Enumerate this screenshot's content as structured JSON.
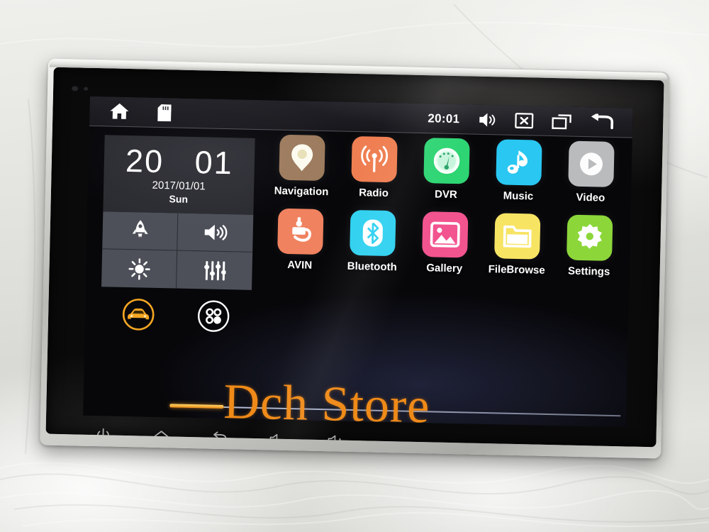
{
  "device": {
    "type": "android-car-head-unit",
    "bezel_color": "#c9c9c5",
    "screen_background": "#07070a"
  },
  "statusbar": {
    "left_icons": [
      {
        "name": "home-icon",
        "label": "Home"
      },
      {
        "name": "sd-card-icon",
        "label": "SD Card"
      }
    ],
    "time": "20:01",
    "right_icons": [
      {
        "name": "volume-icon",
        "label": "Volume"
      },
      {
        "name": "mute-x-icon",
        "label": "Mute"
      },
      {
        "name": "recent-apps-icon",
        "label": "Recent Apps"
      },
      {
        "name": "back-icon",
        "label": "Back"
      }
    ]
  },
  "clock_widget": {
    "hours": "20",
    "minutes": "01",
    "date": "2017/01/01",
    "weekday": "Sun"
  },
  "quick_tiles": [
    {
      "name": "rocket-icon",
      "label": "Boost"
    },
    {
      "name": "volume-icon",
      "label": "Volume"
    },
    {
      "name": "brightness-icon",
      "label": "Brightness"
    },
    {
      "name": "equalizer-icon",
      "label": "Equalizer"
    }
  ],
  "dock": [
    {
      "name": "car-icon",
      "label": "Car",
      "active": true,
      "color": "#f5a623"
    },
    {
      "name": "app-drawer-icon",
      "label": "All Apps",
      "active": false,
      "color": "#ffffff"
    }
  ],
  "apps": [
    {
      "label": "Navigation",
      "icon": "map-pin-icon",
      "bg": "#9c7a5c"
    },
    {
      "label": "Radio",
      "icon": "radio-wave-icon",
      "bg": "#ef7f52"
    },
    {
      "label": "DVR",
      "icon": "dashboard-icon",
      "bg": "#2ed573"
    },
    {
      "label": "Music",
      "icon": "music-note-icon",
      "bg": "#29c7f2"
    },
    {
      "label": "Video",
      "icon": "play-circle-icon",
      "bg": "#b9bbbd"
    },
    {
      "label": "AVIN",
      "icon": "rca-plug-icon",
      "bg": "#f0825f"
    },
    {
      "label": "Bluetooth",
      "icon": "bluetooth-icon",
      "bg": "#2fd1f0"
    },
    {
      "label": "Gallery",
      "icon": "picture-icon",
      "bg": "#f2548f"
    },
    {
      "label": "FileBrowse",
      "icon": "folder-icon",
      "bg": "#f7e463"
    },
    {
      "label": "Settings",
      "icon": "gear-icon",
      "bg": "#8cd63a"
    }
  ],
  "hardware_buttons": [
    {
      "name": "power-button-icon",
      "label": "Power"
    },
    {
      "name": "home-button-icon",
      "label": "Home"
    },
    {
      "name": "back-button-icon",
      "label": "Back"
    },
    {
      "name": "volume-down-button-icon",
      "label": "Volume Down"
    },
    {
      "name": "volume-up-button-icon",
      "label": "Volume Up"
    }
  ],
  "watermark": {
    "text": "Dch Store",
    "color": "#ef8a18"
  }
}
